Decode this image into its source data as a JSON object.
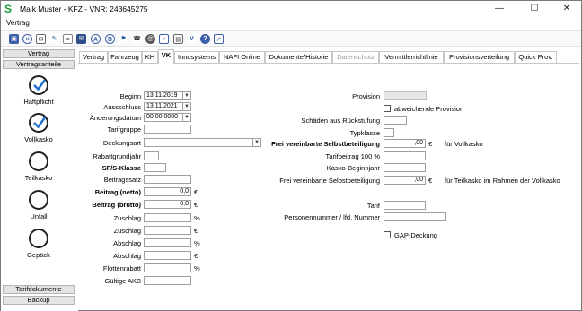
{
  "window": {
    "title": "Maik Muster - KFZ - VNR: 243645275",
    "app_icon": "S",
    "menu": "Vertrag"
  },
  "toolbar": {
    "icons": [
      "save-icon",
      "cancel-icon",
      "email-icon",
      "note-icon",
      "text-icon",
      "envelope-icon",
      "a-icon",
      "b-icon",
      "flag-icon",
      "phone-icon",
      "at-icon",
      "checklist-icon",
      "v-icon",
      "help-icon",
      "export-icon"
    ]
  },
  "sidebar": {
    "top_buttons": [
      "Vertrag",
      "Vertragsanteile"
    ],
    "items": [
      {
        "label": "Haftpflicht",
        "checked": true
      },
      {
        "label": "Vollkasko",
        "checked": true
      },
      {
        "label": "Teilkasko",
        "checked": false
      },
      {
        "label": "Unfall",
        "checked": false
      },
      {
        "label": "Gepäck",
        "checked": false
      }
    ],
    "bottom_buttons": [
      "Tarifdokumente",
      "Backup"
    ]
  },
  "tabs": [
    {
      "label": "Vertrag"
    },
    {
      "label": "Fahrzeug"
    },
    {
      "label": "KH"
    },
    {
      "label": "VK",
      "active": true
    },
    {
      "label": "Innosystems"
    },
    {
      "label": "NAFI Online"
    },
    {
      "label": "Dokumente/Historie"
    },
    {
      "label": "Datenschutz",
      "disabled": true
    },
    {
      "label": "Vermittlerrichtlinie"
    },
    {
      "label": "Provisionsverteilung"
    },
    {
      "label": "Quick Prov."
    }
  ],
  "form": {
    "beginn": {
      "label": "Beginn",
      "value": "13.11.2019"
    },
    "aussschluss": {
      "label": "Aussschluss",
      "value": "13.11.2021"
    },
    "aenderungsdatum": {
      "label": "Änderungsdatum",
      "value": "00.00.0000"
    },
    "tarifgruppe": {
      "label": "Tarifgruppe",
      "value": ""
    },
    "deckungsart": {
      "label": "Deckungsart",
      "value": ""
    },
    "rabattgrundjahr": {
      "label": "Rabattgrundjahr",
      "value": ""
    },
    "sf_klasse": {
      "label": "SF/S-Klasse",
      "value": ""
    },
    "beitragssatz": {
      "label": "Beitragssatz",
      "value": ""
    },
    "beitrag_netto": {
      "label": "Beitrag  (netto)",
      "value": "0,0",
      "unit": "€"
    },
    "beitrag_brutto": {
      "label": "Beitrag  (brutto)",
      "value": "0,0",
      "unit": "€"
    },
    "zuschlag_pct": {
      "label": "Zuschlag",
      "value": "",
      "unit": "%"
    },
    "zuschlag_eur": {
      "label": "Zuschlag",
      "value": "",
      "unit": "€"
    },
    "abschlag_pct": {
      "label": "Abschlag",
      "value": "",
      "unit": "%"
    },
    "abschlag_eur": {
      "label": "Abschlag",
      "value": "",
      "unit": "€"
    },
    "flottenrabatt": {
      "label": "Flottenrabatt",
      "value": "",
      "unit": "%"
    },
    "gueltige_akb": {
      "label": "Gültige AKB",
      "value": ""
    },
    "provision": {
      "label": "Provision",
      "value": ""
    },
    "abweichende_provision": {
      "label": "abweichende Provision",
      "checked": false
    },
    "schaeden": {
      "label": "Schäden aus Rückstufung",
      "value": ""
    },
    "typklasse": {
      "label": "Typklasse",
      "value": ""
    },
    "frei_sb": {
      "label": "Frei vereinbarte Selbstbeteiligung",
      "value": ",00",
      "unit": "€",
      "suffix": "für Vollkasko"
    },
    "tarifbeitrag": {
      "label": "Tarifbeitrag 100 %",
      "value": ""
    },
    "kasko_beginnjahr": {
      "label": "Kasko-Beginnjahr",
      "value": ""
    },
    "frei_sb_tk": {
      "label": "Frei vereinbarte Selbstbeteiligung",
      "value": ",00",
      "unit": "€",
      "suffix": "für Teilkasko im Rahmen der Vollkasko"
    },
    "tarif": {
      "label": "Tarif",
      "value": ""
    },
    "personennummer": {
      "label": "Personennummer / lfd. Nummer",
      "value": ""
    },
    "gap_deckung": {
      "label": "GAP-Deckung",
      "checked": false
    }
  }
}
